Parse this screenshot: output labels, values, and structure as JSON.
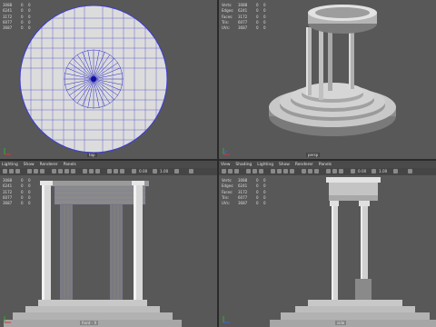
{
  "stats_headers": [
    "Verts:",
    "Edges:",
    "Faces:",
    "Tris:",
    "UVs:"
  ],
  "stats": [
    [
      "3088",
      "0",
      "0"
    ],
    [
      "6241",
      "0",
      "0"
    ],
    [
      "3172",
      "0",
      "0"
    ],
    [
      "6077",
      "0",
      "0"
    ],
    [
      "3687",
      "0",
      "0"
    ]
  ],
  "menus": [
    "Lighting",
    "Show",
    "Renderer",
    "Panels"
  ],
  "menus_persp": [
    "View",
    "Shading",
    "Lighting",
    "Show",
    "Renderer",
    "Panels"
  ],
  "toolbar_values": {
    "near": "0.00",
    "far": "1.00"
  },
  "captions": {
    "top": "top",
    "persp": "persp",
    "front": "front - X",
    "side": "side"
  },
  "colors": {
    "viewport_bg": "#585858",
    "wire": "#2b2bd0",
    "mesh": "#d9d9d9"
  }
}
